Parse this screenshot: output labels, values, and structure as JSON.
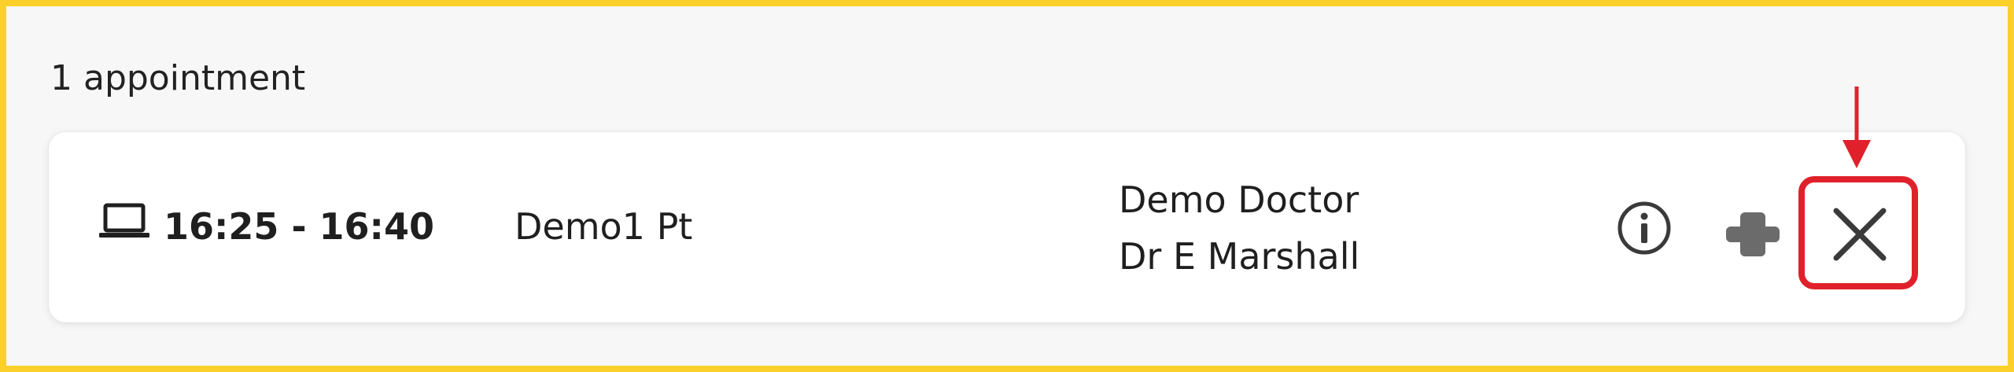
{
  "appointments": {
    "count_label": "1 appointment",
    "items": [
      {
        "mode_icon": "laptop-icon",
        "time_range": "16:25 - 16:40",
        "patient_name": "Demo1 Pt",
        "clinic_name": "Demo Doctor",
        "doctor_name": "Dr E Marshall",
        "actions": [
          {
            "icon": "info-icon"
          },
          {
            "icon": "plus-icon"
          },
          {
            "icon": "close-icon"
          }
        ]
      }
    ]
  },
  "annotation": {
    "highlight_color": "#e0212b",
    "frame_color": "#fcd02a"
  }
}
